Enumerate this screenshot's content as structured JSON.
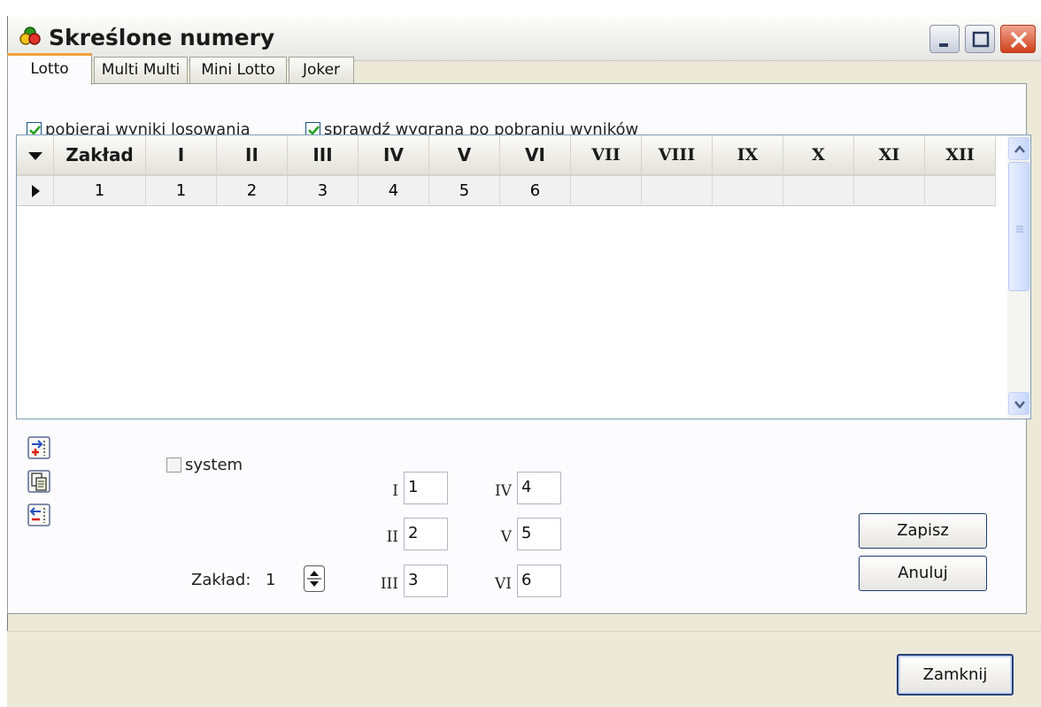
{
  "window": {
    "title": "Skreślone numery"
  },
  "tabs": [
    {
      "label": "Lotto",
      "active": true
    },
    {
      "label": "Multi Multi",
      "active": false
    },
    {
      "label": "Mini Lotto",
      "active": false
    },
    {
      "label": "Joker",
      "active": false
    }
  ],
  "options": {
    "download_results": {
      "label": "pobieraj wyniki losowania",
      "checked": true
    },
    "check_win": {
      "label": "sprawdź wygraną po pobraniu wyników",
      "checked": true
    }
  },
  "grid": {
    "columns": [
      "Zakład",
      "I",
      "II",
      "III",
      "IV",
      "V",
      "VI",
      "VII",
      "VIII",
      "IX",
      "X",
      "XI",
      "XII"
    ],
    "rows": [
      {
        "cells": [
          "1",
          "1",
          "2",
          "3",
          "4",
          "5",
          "6",
          "",
          "",
          "",
          "",
          "",
          ""
        ]
      }
    ]
  },
  "toolbar_icons": [
    "add-row-icon",
    "copy-icon",
    "delete-row-icon"
  ],
  "form": {
    "system_label": "system",
    "system_checked": false,
    "bet_label": "Zakład:",
    "bet_value": "1",
    "numbers": [
      {
        "roman": "I",
        "value": "1"
      },
      {
        "roman": "II",
        "value": "2"
      },
      {
        "roman": "III",
        "value": "3"
      },
      {
        "roman": "IV",
        "value": "4"
      },
      {
        "roman": "V",
        "value": "5"
      },
      {
        "roman": "VI",
        "value": "6"
      }
    ]
  },
  "buttons": {
    "save": "Zapisz",
    "cancel": "Anuluj",
    "close": "Zamknij"
  }
}
